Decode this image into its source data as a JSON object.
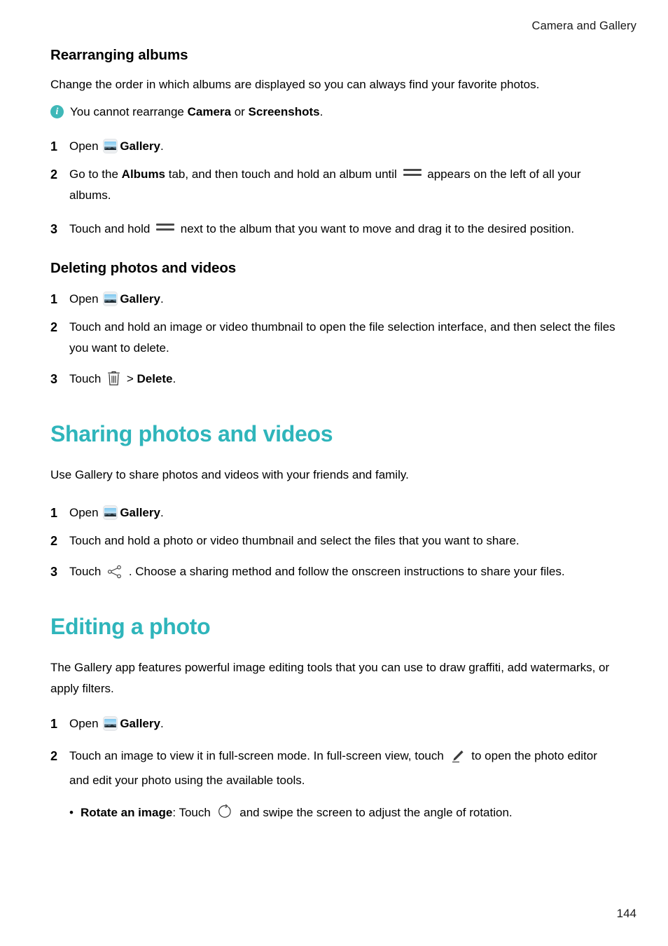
{
  "document": {
    "running_header": "Camera and Gallery",
    "page_number": "144",
    "accent_color": "#2fb5bb",
    "info_icon_color": "#3fb8b8"
  },
  "sections": {
    "rearranging": {
      "heading": "Rearranging albums",
      "intro": "Change the order in which albums are displayed so you can always find your favorite photos.",
      "note": {
        "icon": "info-icon",
        "prefix": "You cannot rearrange ",
        "bold1": "Camera",
        "middle": " or ",
        "bold2": "Screenshots",
        "suffix": "."
      },
      "steps": [
        {
          "num": "1",
          "prefix": "Open ",
          "icon": "gallery-icon",
          "bold": "Gallery",
          "suffix": "."
        },
        {
          "num": "2",
          "prefix": "Go to the ",
          "bold": "Albums",
          "middle": " tab, and then touch and hold an album until ",
          "icon": "drag-handle-icon",
          "suffix": " appears on the left of all your albums."
        },
        {
          "num": "3",
          "prefix": "Touch and hold ",
          "icon": "drag-handle-icon",
          "suffix": " next to the album that you want to move and drag it to the desired position."
        }
      ]
    },
    "deleting": {
      "heading": "Deleting photos and videos",
      "steps": [
        {
          "num": "1",
          "prefix": "Open ",
          "icon": "gallery-icon",
          "bold": "Gallery",
          "suffix": "."
        },
        {
          "num": "2",
          "text": "Touch and hold an image or video thumbnail to open the file selection interface, and then select the files you want to delete."
        },
        {
          "num": "3",
          "prefix": "Touch ",
          "icon": "trash-icon",
          "middle": " > ",
          "bold": "Delete",
          "suffix": "."
        }
      ]
    },
    "sharing": {
      "heading": "Sharing photos and videos",
      "intro": "Use Gallery to share photos and videos with your friends and family.",
      "steps": [
        {
          "num": "1",
          "prefix": "Open ",
          "icon": "gallery-icon",
          "bold": "Gallery",
          "suffix": "."
        },
        {
          "num": "2",
          "text": "Touch and hold a photo or video thumbnail and select the files that you want to share."
        },
        {
          "num": "3",
          "prefix": "Touch ",
          "icon": "share-icon",
          "suffix": " . Choose a sharing method and follow the onscreen instructions to share your files."
        }
      ]
    },
    "editing": {
      "heading": "Editing a photo",
      "intro": "The Gallery app features powerful image editing tools that you can use to draw graffiti, add watermarks, or apply filters.",
      "steps": [
        {
          "num": "1",
          "prefix": "Open ",
          "icon": "gallery-icon",
          "bold": "Gallery",
          "suffix": "."
        },
        {
          "num": "2",
          "prefix": "Touch an image to view it in full-screen mode. In full-screen view, touch ",
          "icon": "pencil-edit-icon",
          "suffix": " to open the photo editor and edit your photo using the available tools."
        }
      ],
      "bullets": [
        {
          "dot": "•",
          "bold": "Rotate an image",
          "prefix": ": Touch ",
          "icon": "rotate-icon",
          "suffix": " and swipe the screen to adjust the angle of rotation."
        }
      ]
    }
  }
}
